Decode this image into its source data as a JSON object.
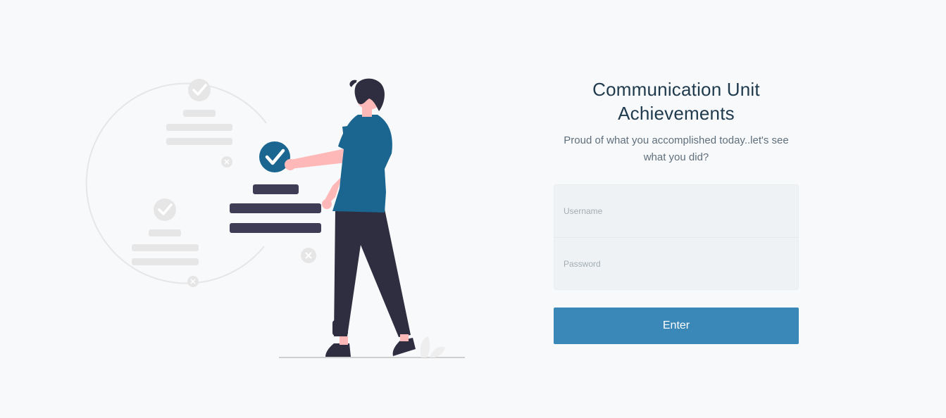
{
  "header": {
    "title": "Communication Unit Achievements",
    "subtitle": "Proud of what you accomplished today..let's see what you did?"
  },
  "form": {
    "username": {
      "value": "",
      "placeholder": "Username"
    },
    "password": {
      "value": "",
      "placeholder": "Password"
    },
    "enter_label": "Enter"
  },
  "colors": {
    "background": "#f8f9fb",
    "accent": "#3a88b8",
    "title": "#1f3a4d",
    "figure_shirt": "#1b6690",
    "figure_pants": "#2f2e41",
    "skin": "#ffb8b8",
    "muted_shape": "#e6e6e6"
  },
  "illustration": {
    "subject": "person-checking-checklist",
    "icons": [
      "check-circle-icon",
      "close-circle-icon"
    ]
  }
}
